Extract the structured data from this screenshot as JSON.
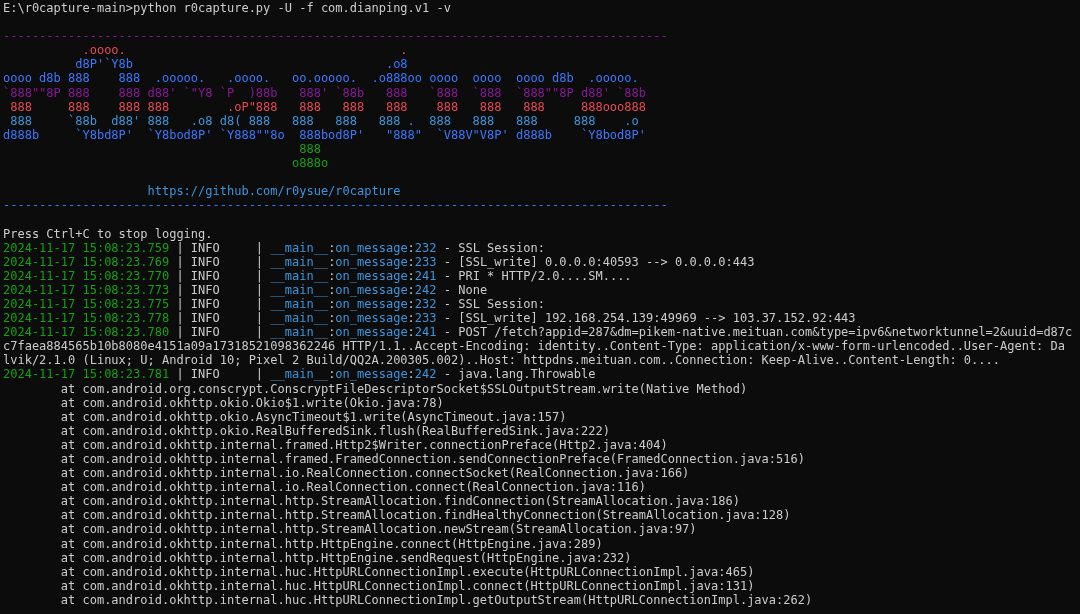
{
  "terminal": {
    "command": "E:\\r0capture-main>python r0capture.py -U -f com.dianping.v1 -v",
    "banner": {
      "rule_top": {
        "text": "--------------------------------------------------------------------------------------------",
        "color": "#881798"
      },
      "art": [
        {
          "text": "           .oooo.                                      .",
          "color": "#e74856"
        },
        {
          "text": "          d8P'`Y8b                                   .o8",
          "color": "#3b78ff"
        },
        {
          "text": "oooo d8b 888    888  .ooooo.   .oooo.   oo.ooooo.  .o888oo oooo  oooo  oooo d8b  .ooooo.",
          "color": "#3b78ff"
        },
        {
          "text": "`888\"\"8P 888    888 d88' `\"Y8 `P  )88b   888' `88b   888   `888  `888  `888\"\"8P d88' `88b",
          "color": "#881798"
        },
        {
          "text": " 888     888    888 888        .oP\"888   888   888   888    888   888   888     888ooo888",
          "color": "#e74856"
        },
        {
          "text": " 888     `88b  d88' 888   .o8 d8( 888   888   888   888 .  888   888   888     888    .o",
          "color": "#3a96dd"
        },
        {
          "text": "d888b     `Y8bd8P'  `Y8bod8P' `Y888\"\"8o  888bod8P'   \"888\"  `V88V\"V8P' d888b    `Y8bod8P'",
          "color": "#3b78ff"
        },
        {
          "text": "                                         888",
          "color": "#13a10e"
        },
        {
          "text": "                                        o888o",
          "color": "#13a10e"
        }
      ],
      "url": "                    https://github.com/r0ysue/r0capture",
      "rule_bottom": {
        "text": "--------------------------------------------------------------------------------------------",
        "color": "#3b78ff"
      }
    },
    "notice": "Press Ctrl+C to stop logging.",
    "log": [
      {
        "segments": [
          {
            "kind": "time",
            "text": "2024-11-17 15:08:23.759"
          },
          {
            "kind": "text",
            "text": " | INFO     | "
          },
          {
            "kind": "source",
            "text": "__main__"
          },
          {
            "kind": "text",
            "text": ":"
          },
          {
            "kind": "source",
            "text": "on_message"
          },
          {
            "kind": "text",
            "text": ":"
          },
          {
            "kind": "source",
            "text": "232"
          },
          {
            "kind": "text",
            "text": " - SSL Session:"
          }
        ]
      },
      {
        "segments": [
          {
            "kind": "time",
            "text": "2024-11-17 15:08:23.769"
          },
          {
            "kind": "text",
            "text": " | INFO     | "
          },
          {
            "kind": "source",
            "text": "__main__"
          },
          {
            "kind": "text",
            "text": ":"
          },
          {
            "kind": "source",
            "text": "on_message"
          },
          {
            "kind": "text",
            "text": ":"
          },
          {
            "kind": "source",
            "text": "233"
          },
          {
            "kind": "text",
            "text": " - [SSL_write] 0.0.0.0:40593 --> 0.0.0.0:443"
          }
        ]
      },
      {
        "segments": [
          {
            "kind": "time",
            "text": "2024-11-17 15:08:23.770"
          },
          {
            "kind": "text",
            "text": " | INFO     | "
          },
          {
            "kind": "source",
            "text": "__main__"
          },
          {
            "kind": "text",
            "text": ":"
          },
          {
            "kind": "source",
            "text": "on_message"
          },
          {
            "kind": "text",
            "text": ":"
          },
          {
            "kind": "source",
            "text": "241"
          },
          {
            "kind": "text",
            "text": " - PRI * HTTP/2.0....SM...."
          }
        ]
      },
      {
        "segments": [
          {
            "kind": "time",
            "text": "2024-11-17 15:08:23.773"
          },
          {
            "kind": "text",
            "text": " | INFO     | "
          },
          {
            "kind": "source",
            "text": "__main__"
          },
          {
            "kind": "text",
            "text": ":"
          },
          {
            "kind": "source",
            "text": "on_message"
          },
          {
            "kind": "text",
            "text": ":"
          },
          {
            "kind": "source",
            "text": "242"
          },
          {
            "kind": "text",
            "text": " - None"
          }
        ]
      },
      {
        "segments": [
          {
            "kind": "time",
            "text": "2024-11-17 15:08:23.775"
          },
          {
            "kind": "text",
            "text": " | INFO     | "
          },
          {
            "kind": "source",
            "text": "__main__"
          },
          {
            "kind": "text",
            "text": ":"
          },
          {
            "kind": "source",
            "text": "on_message"
          },
          {
            "kind": "text",
            "text": ":"
          },
          {
            "kind": "source",
            "text": "232"
          },
          {
            "kind": "text",
            "text": " - SSL Session:"
          }
        ]
      },
      {
        "segments": [
          {
            "kind": "time",
            "text": "2024-11-17 15:08:23.778"
          },
          {
            "kind": "text",
            "text": " | INFO     | "
          },
          {
            "kind": "source",
            "text": "__main__"
          },
          {
            "kind": "text",
            "text": ":"
          },
          {
            "kind": "source",
            "text": "on_message"
          },
          {
            "kind": "text",
            "text": ":"
          },
          {
            "kind": "source",
            "text": "233"
          },
          {
            "kind": "text",
            "text": " - [SSL_write] 192.168.254.139:49969 --> 103.37.152.92:443"
          }
        ]
      },
      {
        "segments": [
          {
            "kind": "time",
            "text": "2024-11-17 15:08:23.780"
          },
          {
            "kind": "text",
            "text": " | INFO     | "
          },
          {
            "kind": "source",
            "text": "__main__"
          },
          {
            "kind": "text",
            "text": ":"
          },
          {
            "kind": "source",
            "text": "on_message"
          },
          {
            "kind": "text",
            "text": ":"
          },
          {
            "kind": "source",
            "text": "241"
          },
          {
            "kind": "text",
            "text": " - POST /fetch?appid=287&dm=pikem-native.meituan.com&type=ipv6&networktunnel=2&uuid=d87c"
          }
        ]
      },
      {
        "segments": [
          {
            "kind": "text",
            "text": "c7faea884565b10b8080e4151a09a17318521098362246 HTTP/1.1..Accept-Encoding: identity..Content-Type: application/x-www-form-urlencoded..User-Agent: Da"
          }
        ]
      },
      {
        "segments": [
          {
            "kind": "text",
            "text": "lvik/2.1.0 (Linux; U; Android 10; Pixel 2 Build/QQ2A.200305.002)..Host: httpdns.meituan.com..Connection: Keep-Alive..Content-Length: 0...."
          }
        ]
      },
      {
        "segments": [
          {
            "kind": "time",
            "text": "2024-11-17 15:08:23.781"
          },
          {
            "kind": "text",
            "text": " | INFO     | "
          },
          {
            "kind": "source",
            "text": "__main__"
          },
          {
            "kind": "text",
            "text": ":"
          },
          {
            "kind": "source",
            "text": "on_message"
          },
          {
            "kind": "text",
            "text": ":"
          },
          {
            "kind": "source",
            "text": "242"
          },
          {
            "kind": "text",
            "text": " - java.lang.Throwable"
          }
        ]
      },
      {
        "segments": [
          {
            "kind": "text",
            "text": "        at com.android.org.conscrypt.ConscryptFileDescriptorSocket$SSLOutputStream.write(Native Method)"
          }
        ]
      },
      {
        "segments": [
          {
            "kind": "text",
            "text": "        at com.android.okhttp.okio.Okio$1.write(Okio.java:78)"
          }
        ]
      },
      {
        "segments": [
          {
            "kind": "text",
            "text": "        at com.android.okhttp.okio.AsyncTimeout$1.write(AsyncTimeout.java:157)"
          }
        ]
      },
      {
        "segments": [
          {
            "kind": "text",
            "text": "        at com.android.okhttp.okio.RealBufferedSink.flush(RealBufferedSink.java:222)"
          }
        ]
      },
      {
        "segments": [
          {
            "kind": "text",
            "text": "        at com.android.okhttp.internal.framed.Http2$Writer.connectionPreface(Http2.java:404)"
          }
        ]
      },
      {
        "segments": [
          {
            "kind": "text",
            "text": "        at com.android.okhttp.internal.framed.FramedConnection.sendConnectionPreface(FramedConnection.java:516)"
          }
        ]
      },
      {
        "segments": [
          {
            "kind": "text",
            "text": "        at com.android.okhttp.internal.io.RealConnection.connectSocket(RealConnection.java:166)"
          }
        ]
      },
      {
        "segments": [
          {
            "kind": "text",
            "text": "        at com.android.okhttp.internal.io.RealConnection.connect(RealConnection.java:116)"
          }
        ]
      },
      {
        "segments": [
          {
            "kind": "text",
            "text": "        at com.android.okhttp.internal.http.StreamAllocation.findConnection(StreamAllocation.java:186)"
          }
        ]
      },
      {
        "segments": [
          {
            "kind": "text",
            "text": "        at com.android.okhttp.internal.http.StreamAllocation.findHealthyConnection(StreamAllocation.java:128)"
          }
        ]
      },
      {
        "segments": [
          {
            "kind": "text",
            "text": "        at com.android.okhttp.internal.http.StreamAllocation.newStream(StreamAllocation.java:97)"
          }
        ]
      },
      {
        "segments": [
          {
            "kind": "text",
            "text": "        at com.android.okhttp.internal.http.HttpEngine.connect(HttpEngine.java:289)"
          }
        ]
      },
      {
        "segments": [
          {
            "kind": "text",
            "text": "        at com.android.okhttp.internal.http.HttpEngine.sendRequest(HttpEngine.java:232)"
          }
        ]
      },
      {
        "segments": [
          {
            "kind": "text",
            "text": "        at com.android.okhttp.internal.huc.HttpURLConnectionImpl.execute(HttpURLConnectionImpl.java:465)"
          }
        ]
      },
      {
        "segments": [
          {
            "kind": "text",
            "text": "        at com.android.okhttp.internal.huc.HttpURLConnectionImpl.connect(HttpURLConnectionImpl.java:131)"
          }
        ]
      },
      {
        "segments": [
          {
            "kind": "text",
            "text": "        at com.android.okhttp.internal.huc.HttpURLConnectionImpl.getOutputStream(HttpURLConnectionImpl.java:262)"
          }
        ]
      }
    ]
  }
}
